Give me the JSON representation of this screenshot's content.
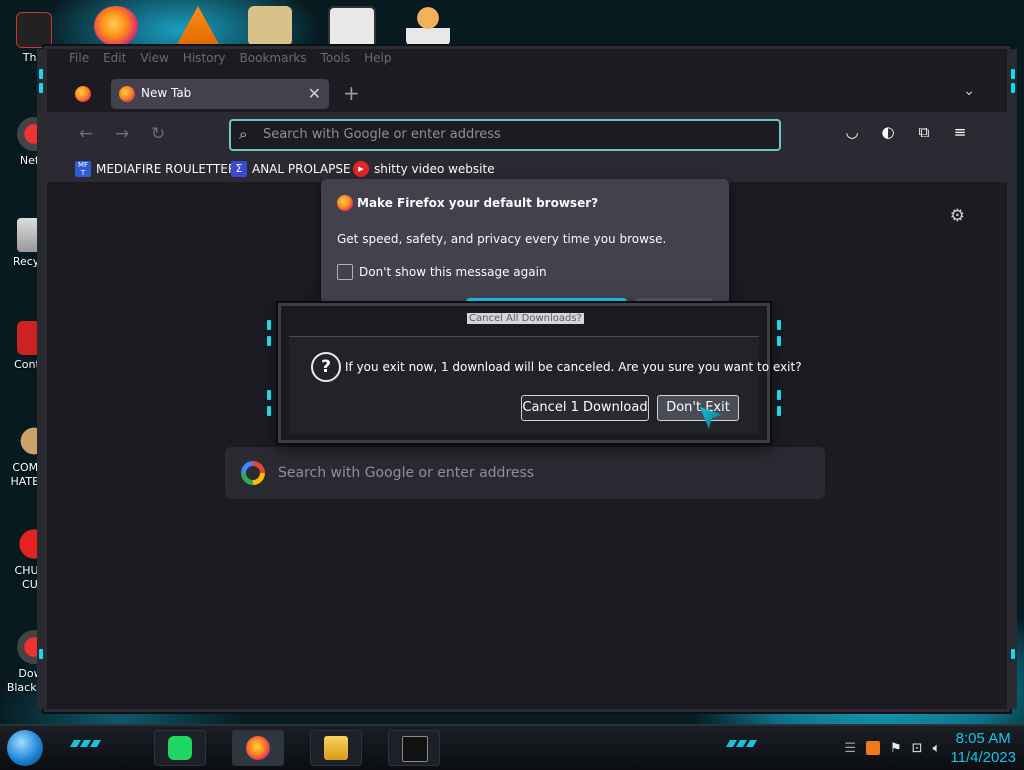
{
  "desktop": {
    "icons": [
      {
        "label": "This",
        "icon": "this-pc-icon"
      },
      {
        "label": "Netw",
        "icon": "network-icon"
      },
      {
        "label": "Recycle",
        "icon": "recycle-bin-icon"
      },
      {
        "label": "Control",
        "icon": "control-panel-icon"
      },
      {
        "label": "COMMU HATE TH",
        "icon": "money-bag-icon"
      },
      {
        "label": "CHUZZ CUN",
        "icon": "chuzzle-icon"
      },
      {
        "label": "Down Black Al...",
        "icon": "download-icon"
      }
    ],
    "top_icons": [
      "firefox-icon",
      "vlc-icon",
      "hxd-icon",
      "maze-icon",
      "person-icon"
    ]
  },
  "browser": {
    "menu": [
      "File",
      "Edit",
      "View",
      "History",
      "Bookmarks",
      "Tools",
      "Help"
    ],
    "tab": {
      "title": "New Tab",
      "close": "✕"
    },
    "new_tab": "+",
    "urlbar": {
      "placeholder": "Search with Google or enter address"
    },
    "bookmarks": [
      {
        "label": "MEDIAFIRE ROULETTER",
        "fav_text": "MF T",
        "color": "#2f5bd6"
      },
      {
        "label": "ANAL PROLAPSE",
        "fav_text": "Σ",
        "color": "#3b4bd0"
      },
      {
        "label": "shitty video website",
        "fav_text": "▶",
        "color": "#e02626"
      }
    ],
    "default_prompt": {
      "title": "Make Firefox your default browser?",
      "body": "Get speed, safety, and privacy every time you browse.",
      "checkbox_label": "Don't show this message again"
    },
    "newtab_search": {
      "placeholder": "Search with Google or enter address"
    }
  },
  "dialog": {
    "title": "Cancel All Downloads?",
    "message": "If you exit now, 1 download will be canceled. Are you sure you want to exit?",
    "cancel_label": "Cancel 1 Download",
    "stay_label": "Don't Exit"
  },
  "taskbar": {
    "time": "8:05 AM",
    "date": "11/4/2023",
    "apps": [
      "spotify-icon",
      "firefox-icon",
      "file-explorer-icon",
      "command-prompt-icon"
    ]
  },
  "colors": {
    "accent": "#16c4e0",
    "url_focus": "#6cc7c9",
    "primary_button": "#19c6ee"
  }
}
